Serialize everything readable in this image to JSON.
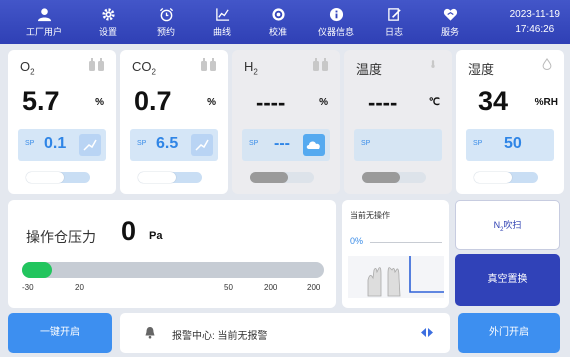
{
  "nav": [
    {
      "label": "工厂用户",
      "icon": "user-icon"
    },
    {
      "label": "设置",
      "icon": "gear-icon"
    },
    {
      "label": "预约",
      "icon": "alarm-clock-icon"
    },
    {
      "label": "曲线",
      "icon": "chart-icon"
    },
    {
      "label": "校准",
      "icon": "target-icon"
    },
    {
      "label": "仪器信息",
      "icon": "info-icon"
    },
    {
      "label": "日志",
      "icon": "log-icon"
    },
    {
      "label": "服务",
      "icon": "service-icon"
    }
  ],
  "clock": {
    "date": "2023-11-19",
    "time": "17:46:26"
  },
  "sensors": [
    {
      "name": "O",
      "sub": "2",
      "value": "5.7",
      "unit": "%",
      "sp_label": "SP",
      "sp_value": "0.1",
      "icon": "gas-bottle-icon"
    },
    {
      "name": "CO",
      "sub": "2",
      "value": "0.7",
      "unit": "%",
      "sp_label": "SP",
      "sp_value": "6.5",
      "icon": "gas-bottle-icon"
    },
    {
      "name": "H",
      "sub": "2",
      "value": "----",
      "unit": "%",
      "sp_label": "SP",
      "sp_value": "---",
      "icon": "gas-bottle-icon"
    },
    {
      "name": "温度",
      "sub": "",
      "value": "----",
      "unit": "℃",
      "sp_label": "SP",
      "sp_value": "",
      "icon": "thermometer-icon"
    },
    {
      "name": "湿度",
      "sub": "",
      "value": "34",
      "unit": "%RH",
      "sp_label": "SP",
      "sp_value": "50",
      "icon": "droplet-icon"
    }
  ],
  "pressure": {
    "title": "操作仓压力",
    "value": "0",
    "unit": "Pa",
    "level": 0.1,
    "ticks": [
      "-30",
      "20",
      "50",
      "200",
      "200"
    ]
  },
  "operation": {
    "status": "当前无操作",
    "progress": "0%"
  },
  "buttons": {
    "n2_prefix": "N",
    "n2_sub": "2",
    "n2_suffix": "吹扫",
    "vacuum": "真空置换",
    "one_key": "一键开启",
    "outer_door": "外门开启"
  },
  "alarm": {
    "text": "报警中心: 当前无报警"
  },
  "colors": {
    "header": "#3445bc",
    "accent": "#3d8ff0",
    "green": "#22c55e",
    "dark_button": "#3042b8"
  }
}
